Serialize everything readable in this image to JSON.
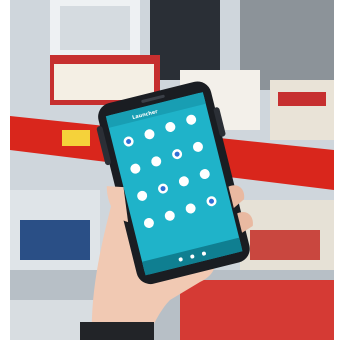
{
  "scene": {
    "description_free": true,
    "shelf_color": "#d9261c",
    "screen_color": "#1fb3c9",
    "phone_body_color": "#1a1d22"
  },
  "phone_screen": {
    "header_title": "Launcher",
    "app_labels": [
      "",
      "",
      "",
      "",
      "",
      "",
      "",
      "",
      "",
      "",
      "",
      "",
      "",
      "",
      "",
      ""
    ]
  }
}
